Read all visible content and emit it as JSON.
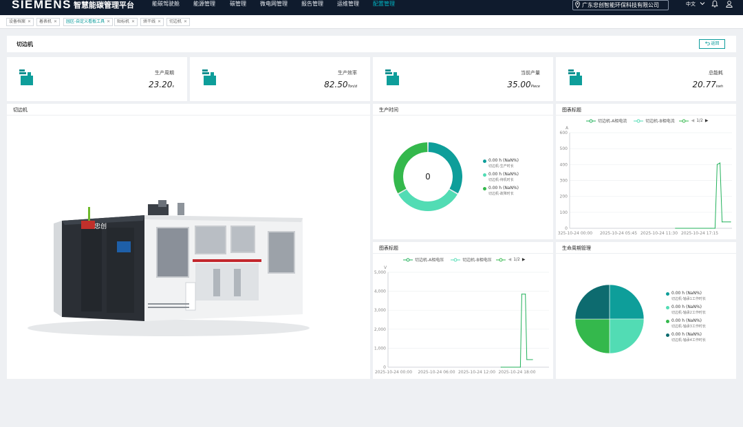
{
  "header": {
    "brand": "SIEMENS",
    "platform": "智慧能碳管理平台",
    "nav": [
      {
        "label": "能碳驾驶舱",
        "active": false
      },
      {
        "label": "能源管理",
        "active": false
      },
      {
        "label": "碳管理",
        "active": false
      },
      {
        "label": "微电网管理",
        "active": false
      },
      {
        "label": "报告管理",
        "active": false
      },
      {
        "label": "运维管理",
        "active": false
      },
      {
        "label": "配置管理",
        "active": true
      }
    ],
    "company": "广东忠创智能环保科技有限公司",
    "language": "中文"
  },
  "tabs": [
    {
      "label": "设备档案",
      "active": false
    },
    {
      "label": "着表机",
      "active": false
    },
    {
      "label": "园区-自定义看板工具",
      "active": true
    },
    {
      "label": "贴标机",
      "active": false
    },
    {
      "label": "烘干线",
      "active": false
    },
    {
      "label": "切边机",
      "active": false
    }
  ],
  "page": {
    "title": "切边机",
    "back_label": "返回"
  },
  "metrics": [
    {
      "label": "生产周期",
      "value": "23.20",
      "unit": "s"
    },
    {
      "label": "生产效率",
      "value": "82.50",
      "unit": "Ton/d"
    },
    {
      "label": "当前产量",
      "value": "35.00",
      "unit": "Piece"
    },
    {
      "label": "总能耗",
      "value": "20.77",
      "unit": "kwh"
    }
  ],
  "machine_panel": {
    "title": "切边机",
    "brand_mark": "忠创"
  },
  "production_time": {
    "title": "生产时间",
    "center_value": "0",
    "legend": [
      {
        "value": "0.00 h (NaN%)",
        "label": "切边机-生产时长",
        "color": "#0e9e9a"
      },
      {
        "value": "0.00 h (NaN%)",
        "label": "切边机-待机时长",
        "color": "#52dcb4"
      },
      {
        "value": "0.00 h (NaN%)",
        "label": "切边机-故障时长",
        "color": "#34b84c"
      }
    ]
  },
  "current_chart": {
    "title": "图表标题",
    "legend": [
      "切边机-A相电流",
      "切边机-B相电流"
    ],
    "pager": "1/2"
  },
  "voltage_chart": {
    "title": "图表标题",
    "legend": [
      "切边机-A相电压",
      "切边机-B相电压"
    ],
    "pager": "1/2"
  },
  "lifecycle": {
    "title": "生命周期管理",
    "legend": [
      {
        "value": "0.00 h (NaN%)",
        "label": "切边机-轴承1工作时长",
        "color": "#0e9e9a"
      },
      {
        "value": "0.00 h (NaN%)",
        "label": "切边机-轴承2工作时长",
        "color": "#52dcb4"
      },
      {
        "value": "0.00 h (NaN%)",
        "label": "切边机-轴承3工作时长",
        "color": "#34b84c"
      },
      {
        "value": "0.00 h (NaN%)",
        "label": "切边机-轴承4工作时长",
        "color": "#0d6b6f"
      }
    ]
  },
  "chart_data": [
    {
      "type": "line",
      "title": "图表标题",
      "ylabel": "A",
      "ylim": [
        0,
        600
      ],
      "yticks": [
        "0",
        "100",
        "200",
        "300",
        "400",
        "500",
        "600"
      ],
      "xticks": [
        "325-10-24 00:00",
        "2025-10-24 05:45",
        "2025-10-24 11:30",
        "2025-10-24 17:15"
      ],
      "xlim_hours": [
        0,
        23
      ],
      "series": [
        {
          "name": "切边机-A相电流",
          "color": "#21b15a",
          "points": [
            [
              15,
              0
            ],
            [
              20,
              0
            ],
            [
              20.6,
              0
            ],
            [
              20.9,
              400
            ],
            [
              21.3,
              410
            ],
            [
              21.6,
              40
            ],
            [
              22.8,
              40
            ]
          ]
        }
      ]
    },
    {
      "type": "line",
      "title": "图表标题",
      "ylabel": "V",
      "ylim": [
        0,
        5000
      ],
      "yticks": [
        "0",
        "1,000",
        "2,000",
        "3,000",
        "4,000",
        "5,000"
      ],
      "xticks": [
        "2025-10-24 00:00",
        "2025-10-24 06:00",
        "2025-10-24 12:00",
        "2025-10-24 18:00"
      ],
      "xlim_hours": [
        0,
        22.5
      ],
      "series": [
        {
          "name": "切边机-A相电压",
          "color": "#21b15a",
          "points": [
            [
              15.8,
              0
            ],
            [
              18.5,
              0
            ],
            [
              18.7,
              3850
            ],
            [
              19.2,
              3850
            ],
            [
              19.4,
              400
            ],
            [
              20.2,
              400
            ]
          ]
        }
      ]
    }
  ]
}
